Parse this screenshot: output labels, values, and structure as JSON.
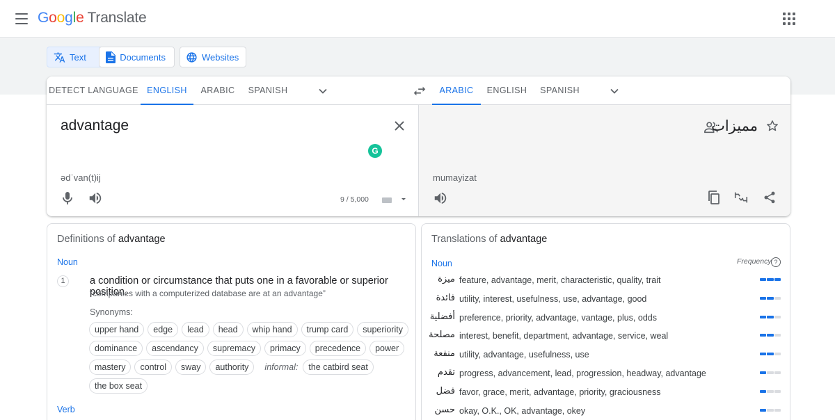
{
  "header": {
    "logo": {
      "g1": "G",
      "g2": "o",
      "g3": "o",
      "g4": "g",
      "g5": "l",
      "g6": "e",
      "suffix": "Translate"
    }
  },
  "modes": [
    {
      "label": "Text",
      "icon": "translate-icon",
      "active": true
    },
    {
      "label": "Documents",
      "icon": "document-icon",
      "active": false
    },
    {
      "label": "Websites",
      "icon": "globe-icon",
      "active": false
    }
  ],
  "source_tabs": [
    "DETECT LANGUAGE",
    "ENGLISH",
    "ARABIC",
    "SPANISH"
  ],
  "target_tabs": [
    "ARABIC",
    "ENGLISH",
    "SPANISH"
  ],
  "source": {
    "text": "advantage",
    "phonetic": "ədˈvan(t)ij",
    "counter": "9 / 5,000"
  },
  "target": {
    "text": "مميزات",
    "transliteration": "mumayizat"
  },
  "definitions": {
    "title_prefix": "Definitions of",
    "word": "advantage",
    "pos_noun": "Noun",
    "num": "1",
    "definition": "a condition or circumstance that puts one in a favorable or superior position.",
    "example": "“companies with a computerized database are at an advantage”",
    "synonyms_label": "Synonyms:",
    "synonyms": [
      "upper hand",
      "edge",
      "lead",
      "head",
      "whip hand",
      "trump card",
      "superiority",
      "dominance",
      "ascendancy",
      "supremacy",
      "primacy",
      "precedence",
      "power",
      "mastery",
      "control",
      "sway",
      "authority"
    ],
    "informal_label": "informal:",
    "informal_synonyms": [
      "the catbird seat",
      "the box seat"
    ],
    "pos_verb": "Verb"
  },
  "translations": {
    "title_prefix": "Translations of",
    "word": "advantage",
    "pos": "Noun",
    "frequency_label": "Frequency",
    "help": "?",
    "rows": [
      {
        "ar": "ميزة",
        "en": "feature, advantage, merit, characteristic, quality, trait",
        "freq": 3
      },
      {
        "ar": "فائدة",
        "en": "utility, interest, usefulness, use, advantage, good",
        "freq": 2
      },
      {
        "ar": "أفضلية",
        "en": "preference, priority, advantage, vantage, plus, odds",
        "freq": 2
      },
      {
        "ar": "مصلحة",
        "en": "interest, benefit, department, advantage, service, weal",
        "freq": 2
      },
      {
        "ar": "منفعة",
        "en": "utility, advantage, usefulness, use",
        "freq": 2
      },
      {
        "ar": "تقدم",
        "en": "progress, advancement, lead, progression, headway, advantage",
        "freq": 1
      },
      {
        "ar": "فضل",
        "en": "favor, grace, merit, advantage, priority, graciousness",
        "freq": 1
      },
      {
        "ar": "حسن",
        "en": "okay, O.K., OK, advantage, okey",
        "freq": 1
      }
    ]
  },
  "colors": {
    "accent": "#1a73e8",
    "grammarly": "#15c39a",
    "band": "#f1f3f4"
  }
}
